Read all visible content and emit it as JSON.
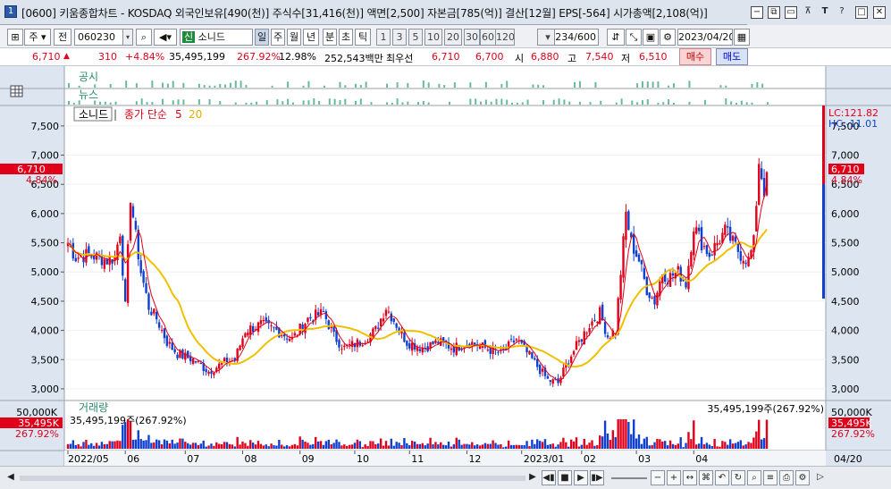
{
  "window": {
    "title": "[0600] 키움종합차트 - KOSDAQ 외국인보유[490(천)] 주식수[31,416(천)] 액면[2,500] 자본금[785(억)] 결산[12월] EPS[-564] 시가총액[2,108(억)]",
    "app_icon": "1",
    "controls": [
      "−",
      "⧉",
      "▭",
      "⊼",
      "T",
      "?",
      "□",
      "✕"
    ]
  },
  "toolbar": {
    "period": "주",
    "type": "전",
    "code": "060230",
    "name": "소니드",
    "name_badge": "신",
    "intervals": [
      "일",
      "주",
      "월",
      "년",
      "분",
      "초",
      "틱"
    ],
    "minutes": [
      "1",
      "3",
      "5",
      "10",
      "20",
      "30",
      "60",
      "120"
    ],
    "count_value": "234",
    "count_total": "/600",
    "date": "2023/04/20"
  },
  "price": {
    "current": "6,710",
    "change": "310",
    "change_pct": "+4.84%",
    "volume": "35,495,199",
    "volume_ratio": "267.92%",
    "turnover": "12.98%",
    "amount": "252,543백만",
    "priority": "최우선",
    "ask": "6,710",
    "bid": "6,700",
    "open_label": "시",
    "open": "6,880",
    "high_label": "고",
    "high": "7,540",
    "low_label": "저",
    "low": "6,510",
    "buy_label": "매수",
    "sell_label": "매도"
  },
  "panels": {
    "notice_label": "공시",
    "news_label": "뉴스",
    "price_legend": {
      "name": "소니드",
      "ma_label": "종가 단순",
      "ma1": "5",
      "ma2": "20"
    },
    "lc": "LC:121.82",
    "hc": "HC:-11.01",
    "left_current": "6,710",
    "left_pct": "4.84%",
    "right_current": "6,710",
    "right_pct": "4.84%",
    "volume_label": "거래량",
    "volume_summary": "35,495,199주(267.92%)",
    "volume_left_top": "50,000K",
    "volume_left_cur": "35,495K",
    "volume_left_pct": "267.92%",
    "volume_right_top": "50,000K",
    "volume_right_cur": "35,495K",
    "volume_right_pct": "267.92%"
  },
  "colors": {
    "up": "#e0001a",
    "down": "#1040d0",
    "ma5": "#e0001a",
    "ma20": "#f0c000",
    "marker": "#66bb99"
  },
  "chart_data": {
    "type": "candlestick",
    "y_ticks": [
      "7,500",
      "7,000",
      "6,500",
      "6,000",
      "5,500",
      "5,000",
      "4,500",
      "4,000",
      "3,500",
      "3,000"
    ],
    "y_range": [
      2800,
      7850
    ],
    "x_labels": [
      "2022/05",
      "06",
      "07",
      "08",
      "09",
      "10",
      "11",
      "12",
      "2023/01",
      "02",
      "03",
      "04"
    ],
    "right_date": "04/20",
    "anchors": [
      {
        "d": 0,
        "c": 5500
      },
      {
        "d": 3,
        "c": 5250
      },
      {
        "d": 8,
        "c": 5300
      },
      {
        "d": 15,
        "c": 5200
      },
      {
        "d": 18,
        "c": 5250
      },
      {
        "d": 20,
        "c": 5700
      },
      {
        "d": 22,
        "c": 4400
      },
      {
        "d": 24,
        "c": 6300
      },
      {
        "d": 26,
        "c": 5600
      },
      {
        "d": 28,
        "c": 5000
      },
      {
        "d": 31,
        "c": 4400
      },
      {
        "d": 34,
        "c": 4200
      },
      {
        "d": 38,
        "c": 3800
      },
      {
        "d": 42,
        "c": 3600
      },
      {
        "d": 48,
        "c": 3500
      },
      {
        "d": 54,
        "c": 3300
      },
      {
        "d": 60,
        "c": 3450
      },
      {
        "d": 64,
        "c": 3500
      },
      {
        "d": 68,
        "c": 4000
      },
      {
        "d": 74,
        "c": 4100
      },
      {
        "d": 80,
        "c": 4000
      },
      {
        "d": 86,
        "c": 3850
      },
      {
        "d": 92,
        "c": 4200
      },
      {
        "d": 98,
        "c": 4300
      },
      {
        "d": 102,
        "c": 3900
      },
      {
        "d": 106,
        "c": 3700
      },
      {
        "d": 112,
        "c": 3800
      },
      {
        "d": 118,
        "c": 4000
      },
      {
        "d": 122,
        "c": 4400
      },
      {
        "d": 126,
        "c": 4100
      },
      {
        "d": 130,
        "c": 3800
      },
      {
        "d": 136,
        "c": 3700
      },
      {
        "d": 142,
        "c": 3800
      },
      {
        "d": 148,
        "c": 3700
      },
      {
        "d": 154,
        "c": 3800
      },
      {
        "d": 160,
        "c": 3700
      },
      {
        "d": 166,
        "c": 3600
      },
      {
        "d": 172,
        "c": 3850
      },
      {
        "d": 178,
        "c": 3500
      },
      {
        "d": 184,
        "c": 3150
      },
      {
        "d": 188,
        "c": 3100
      },
      {
        "d": 192,
        "c": 3500
      },
      {
        "d": 196,
        "c": 3800
      },
      {
        "d": 200,
        "c": 4100
      },
      {
        "d": 204,
        "c": 4300
      },
      {
        "d": 207,
        "c": 3900
      },
      {
        "d": 210,
        "c": 4000
      },
      {
        "d": 212,
        "c": 5000
      },
      {
        "d": 214,
        "c": 6000
      },
      {
        "d": 216,
        "c": 5500
      },
      {
        "d": 219,
        "c": 5200
      },
      {
        "d": 222,
        "c": 4700
      },
      {
        "d": 225,
        "c": 4500
      },
      {
        "d": 228,
        "c": 5000
      },
      {
        "d": 230,
        "c": 4900
      },
      {
        "d": 234,
        "c": 5000
      },
      {
        "d": 237,
        "c": 4800
      },
      {
        "d": 240,
        "c": 5800
      },
      {
        "d": 243,
        "c": 5500
      },
      {
        "d": 246,
        "c": 5300
      },
      {
        "d": 249,
        "c": 5500
      },
      {
        "d": 252,
        "c": 5700
      },
      {
        "d": 255,
        "c": 5500
      },
      {
        "d": 258,
        "c": 5300
      },
      {
        "d": 261,
        "c": 5200
      },
      {
        "d": 263,
        "c": 5500
      },
      {
        "d": 265,
        "c": 6900
      },
      {
        "d": 267,
        "c": 6400
      },
      {
        "d": 268,
        "c": 6710
      }
    ]
  }
}
